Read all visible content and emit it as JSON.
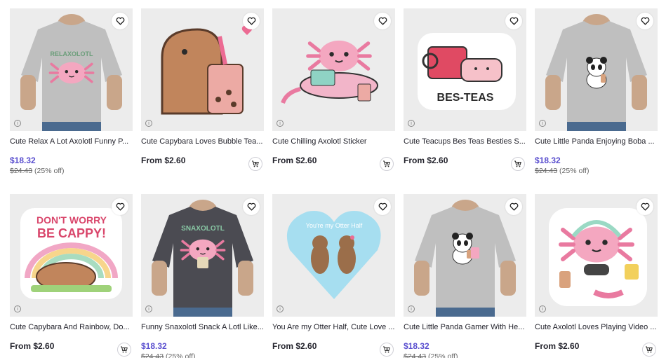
{
  "products": [
    {
      "title": "Cute Relax A Lot Axolotl Funny P...",
      "price": "$18.32",
      "old_price": "$24.43",
      "discount": "(25% off)",
      "sale": true,
      "art": "tee-light",
      "art_text": "RELAXOLOTL"
    },
    {
      "title": "Cute Capybara Loves Bubble Tea...",
      "price": "From $2.60",
      "sale": false,
      "art": "capybara-boba"
    },
    {
      "title": "Cute Chilling Axolotl Sticker",
      "price": "From $2.60",
      "sale": false,
      "art": "axolotl-chill"
    },
    {
      "title": "Cute Teacups Bes Teas Besties S...",
      "price": "From $2.60",
      "sale": false,
      "art": "besteas",
      "art_text": "BES-TEAS"
    },
    {
      "title": "Cute Little Panda Enjoying Boba ...",
      "price": "$18.32",
      "old_price": "$24.43",
      "discount": "(25% off)",
      "sale": true,
      "art": "tee-panda"
    },
    {
      "title": "Cute Capybara And Rainbow, Do...",
      "price": "From $2.60",
      "sale": false,
      "art": "cappy",
      "art_text": "DON'T WORRY BE CAPPY!"
    },
    {
      "title": "Funny Snaxolotl Snack A Lotl Like...",
      "price": "$18.32",
      "old_price": "$24.43",
      "discount": "(25% off)",
      "sale": true,
      "art": "tee-dark",
      "art_text": "SNAXOLOTL"
    },
    {
      "title": "You Are my Otter Half, Cute Love ...",
      "price": "From $2.60",
      "sale": false,
      "art": "otters",
      "art_text": "You're my Otter Half"
    },
    {
      "title": "Cute Little Panda Gamer With He...",
      "price": "$18.32",
      "old_price": "$24.43",
      "discount": "(25% off)",
      "sale": true,
      "art": "tee-panda-gamer"
    },
    {
      "title": "Cute Axolotl Loves Playing Video ...",
      "price": "From $2.60",
      "sale": false,
      "art": "axolotl-gamer"
    }
  ],
  "colors": {
    "sale_price": "#5a4fcf",
    "thumb_bg": "#ececec"
  },
  "icons": {
    "favorite": "heart-outline-icon",
    "cart": "add-to-cart-icon",
    "info": "info-icon"
  }
}
